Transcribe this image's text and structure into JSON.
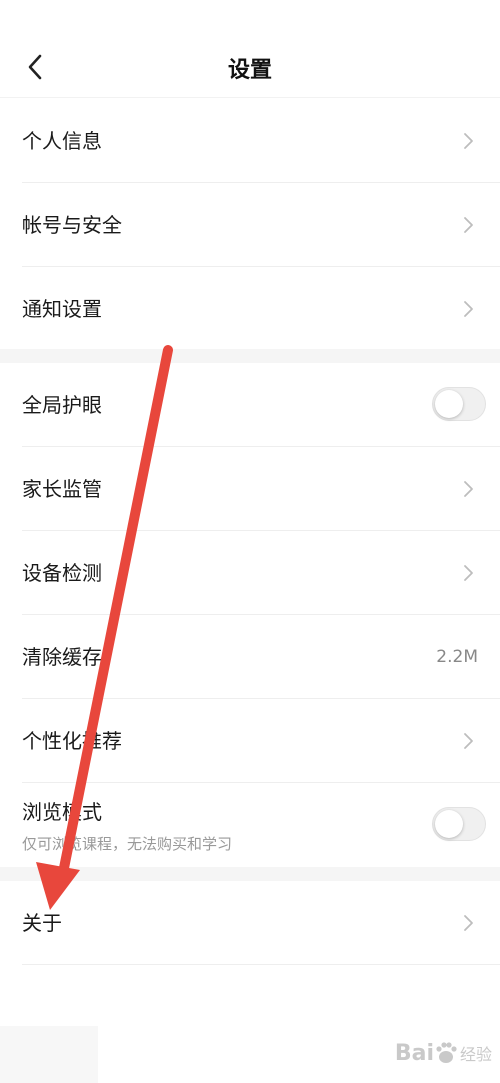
{
  "header": {
    "title": "设置",
    "back_icon": "chevron-left-icon"
  },
  "group1": {
    "items": [
      {
        "label": "个人信息",
        "icon": "chevron-right-icon"
      },
      {
        "label": "帐号与安全",
        "icon": "chevron-right-icon"
      },
      {
        "label": "通知设置",
        "icon": "chevron-right-icon"
      }
    ]
  },
  "group2": {
    "items": [
      {
        "label": "全局护眼",
        "control": "toggle",
        "state": "off"
      },
      {
        "label": "家长监管",
        "icon": "chevron-right-icon"
      },
      {
        "label": "设备检测",
        "icon": "chevron-right-icon"
      },
      {
        "label": "清除缓存",
        "value": "2.2M"
      },
      {
        "label": "个性化推荐",
        "icon": "chevron-right-icon"
      },
      {
        "label": "浏览模式",
        "sublabel": "仅可浏览课程，无法购买和学习",
        "control": "toggle",
        "state": "off"
      }
    ]
  },
  "group3": {
    "items": [
      {
        "label": "关于",
        "icon": "chevron-right-icon"
      }
    ]
  },
  "watermark": {
    "text": "Bai",
    "sub": "经验"
  },
  "colors": {
    "annotation_arrow": "#e8473c",
    "section_gap": "#f5f5f5"
  }
}
